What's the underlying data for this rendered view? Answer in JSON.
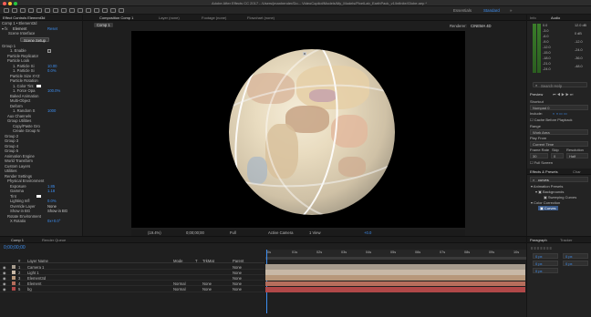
{
  "app": {
    "window_title": "Adobe After Effects CC 2017 - /Users/jmanhender/Do... VideoCopilot/Models/My_Models/PixelLab_EarthPack_v1/Infinite/Globe.aep *",
    "workspaces": [
      "Essentials",
      "Standard"
    ],
    "active_workspace": "Standard"
  },
  "effect_controls": {
    "tab_label": "Effect Controls Element3d",
    "layer_path": "Comp 1 • Element3d",
    "effect_name": "Element",
    "reset_label": "Reset",
    "scene_interface_label": "Scene Interface",
    "scene_setup_button": "Scene Setup",
    "rows": [
      {
        "label": "Group 1",
        "indent": 0
      },
      {
        "label": "1. Enable",
        "indent": 3,
        "check": true
      },
      {
        "label": "Particle Replicator",
        "indent": 2
      },
      {
        "label": "Particle Look",
        "indent": 2
      },
      {
        "label": "1. Particle Si",
        "indent": 4,
        "value": "10.00"
      },
      {
        "label": "1. Particle Si",
        "indent": 4,
        "value": "0.0%"
      },
      {
        "label": "Particle Size XYZ",
        "indent": 3
      },
      {
        "label": "Particle Rotation",
        "indent": 3
      },
      {
        "label": "1. Color Tint",
        "indent": 4,
        "swatch": true
      },
      {
        "label": "1. Force Opa",
        "indent": 4,
        "value": "100.0%"
      },
      {
        "label": "Baked Animation",
        "indent": 3
      },
      {
        "label": "Multi-Object",
        "indent": 3
      },
      {
        "label": "Deform",
        "indent": 3
      },
      {
        "label": "1. Random S",
        "indent": 4,
        "value": "1000"
      },
      {
        "label": "Aux Channels",
        "indent": 2
      },
      {
        "label": "Group Utilities",
        "indent": 2
      },
      {
        "label": "Copy/Paste Gro",
        "indent": 4
      },
      {
        "label": "Create Group N",
        "indent": 4
      },
      {
        "label": "Group 2",
        "indent": 1
      },
      {
        "label": "Group 3",
        "indent": 1
      },
      {
        "label": "Group 4",
        "indent": 1
      },
      {
        "label": "Group 5",
        "indent": 1
      },
      {
        "label": "Animation Engine",
        "indent": 1
      },
      {
        "label": "World Transform",
        "indent": 1
      },
      {
        "label": "Custom Layers",
        "indent": 1
      },
      {
        "label": "Utilities",
        "indent": 1
      },
      {
        "label": "Render Settings",
        "indent": 1
      },
      {
        "label": "Physical Environment",
        "indent": 2
      },
      {
        "label": "Exposure",
        "indent": 3,
        "value": "1.85"
      },
      {
        "label": "Gamma",
        "indent": 3,
        "value": "1.18"
      },
      {
        "label": "Tint",
        "indent": 3,
        "swatch": true
      },
      {
        "label": "Lighting Infl",
        "indent": 3,
        "value": "0.0%"
      },
      {
        "label": "Override Layer",
        "indent": 3,
        "plain": "None"
      },
      {
        "label": "Show in BG",
        "indent": 3,
        "plain": "Show in BG"
      },
      {
        "label": "Rotate Environment",
        "indent": 2
      },
      {
        "label": "X Rotatio",
        "indent": 3,
        "value": "0x+0.0°"
      }
    ]
  },
  "composition": {
    "tabs": [
      "Composition Comp 1",
      "Layer (none)",
      "Footage (none)",
      "Flowchart (none)"
    ],
    "comp_button": "Comp 1",
    "renderer_label": "Renderer:",
    "renderer_value": "CINEMA 4D",
    "viewer_bar": {
      "zoom": "(19.4%)",
      "timecode": "0;00;00;00",
      "resolution": "Full",
      "camera": "Active Camera",
      "views": "1 View",
      "exposure": "+0.0"
    }
  },
  "info_audio": {
    "tabs": [
      "Info",
      "Audio"
    ],
    "db_left": [
      "0.0",
      "-3.0",
      "-6.0",
      "-9.0",
      "-12.0",
      "-15.0",
      "-18.0",
      "-21.0",
      "-24.0"
    ],
    "db_right": [
      "12.0 dB",
      "0 dB",
      "-12.0",
      "-24.0",
      "-36.0",
      "-48.0"
    ]
  },
  "search_help": {
    "placeholder": "Search Help"
  },
  "preview": {
    "title": "Preview",
    "shortcut_label": "Shortcut",
    "shortcut_value": "Numpad 0",
    "include_label": "Include:",
    "cache_label": "Cache Before Playback",
    "range_label": "Range",
    "range_value": "Work Area",
    "play_from_label": "Play From",
    "play_from_value": "Current Time",
    "frame_rate_label": "Frame Rate",
    "skip_label": "Skip",
    "resolution_label": "Resolution",
    "frame_rate_value": "30",
    "skip_value": "0",
    "resolution_value": "Half",
    "fullscreen_label": "Full Screen"
  },
  "effects_presets": {
    "tabs": [
      "Effects & Presets",
      "Char"
    ],
    "search_value": "curves",
    "tree": [
      "Animation Presets",
      "Backgrounds",
      "Sweeping Curves",
      "Color Correction",
      "Curves"
    ]
  },
  "timeline": {
    "tabs": [
      "Comp 1",
      "Render Queue"
    ],
    "timecode": "0;00;00;00",
    "columns": [
      "#",
      "Layer Name",
      "Mode",
      "T",
      "TrkMat",
      "Parent"
    ],
    "layers": [
      {
        "num": "1",
        "name": "Camera 1",
        "mode": "",
        "trkmat": "",
        "parent": "None",
        "color": "#a79c8e"
      },
      {
        "num": "2",
        "name": "Light 1",
        "mode": "",
        "trkmat": "",
        "parent": "None",
        "color": "#c8b8a6"
      },
      {
        "num": "3",
        "name": "Element3d",
        "mode": "",
        "trkmat": "",
        "parent": "None",
        "color": "#b7977a"
      },
      {
        "num": "4",
        "name": "Element",
        "mode": "Normal",
        "trkmat": "None",
        "parent": "None",
        "color": "#b66e5c"
      },
      {
        "num": "5",
        "name": "bg",
        "mode": "Normal",
        "trkmat": "None",
        "parent": "None",
        "color": "#b04848"
      }
    ],
    "ruler": [
      "0s",
      "01s",
      "02s",
      "03s",
      "04s",
      "05s",
      "06s",
      "07s",
      "08s",
      "09s",
      "10s"
    ]
  },
  "paragraph": {
    "tabs": [
      "Paragraph",
      "Tracker"
    ],
    "fields": [
      "0 px",
      "0 px",
      "0 px",
      "0 px",
      "0 px"
    ]
  }
}
